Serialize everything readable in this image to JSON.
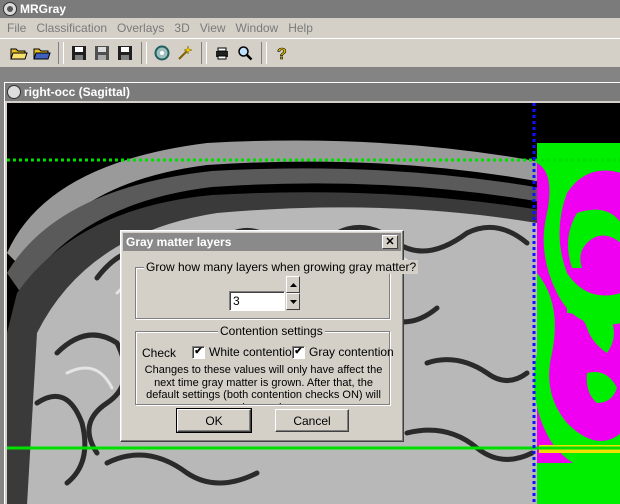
{
  "app": {
    "title": "MRGray"
  },
  "menu": [
    "File",
    "Classification",
    "Overlays",
    "3D",
    "View",
    "Window",
    "Help"
  ],
  "toolbar": {
    "buttons": [
      "open-folder-icon",
      "open-file-icon",
      "save-icon",
      "save-as-icon",
      "save-all-icon",
      "disc-icon",
      "magic-wand-icon",
      "print-icon",
      "zoom-icon",
      "help-icon"
    ]
  },
  "child_window": {
    "title": "right-occ (Sagittal)"
  },
  "dialog": {
    "title": "Gray matter layers",
    "close_glyph": "✕",
    "layers_group_label": "Grow how many layers when growing gray matter?",
    "layers_value": "3",
    "contention_group_label": "Contention settings",
    "check_label": "Check",
    "white_contention_label": "White contention",
    "white_contention_checked": true,
    "gray_contention_label": "Gray contention",
    "gray_contention_checked": true,
    "note": "Changes to these values will only have affect the next time gray matter is grown.  After that, the default settings (both contention checks ON) will be used.",
    "ok_label": "OK",
    "cancel_label": "Cancel"
  },
  "colors": {
    "crosshair_green": "#00e000",
    "crosshair_blue": "#1010ff",
    "gray_matter": "#ff00ff",
    "white_matter": "#00ff00"
  }
}
